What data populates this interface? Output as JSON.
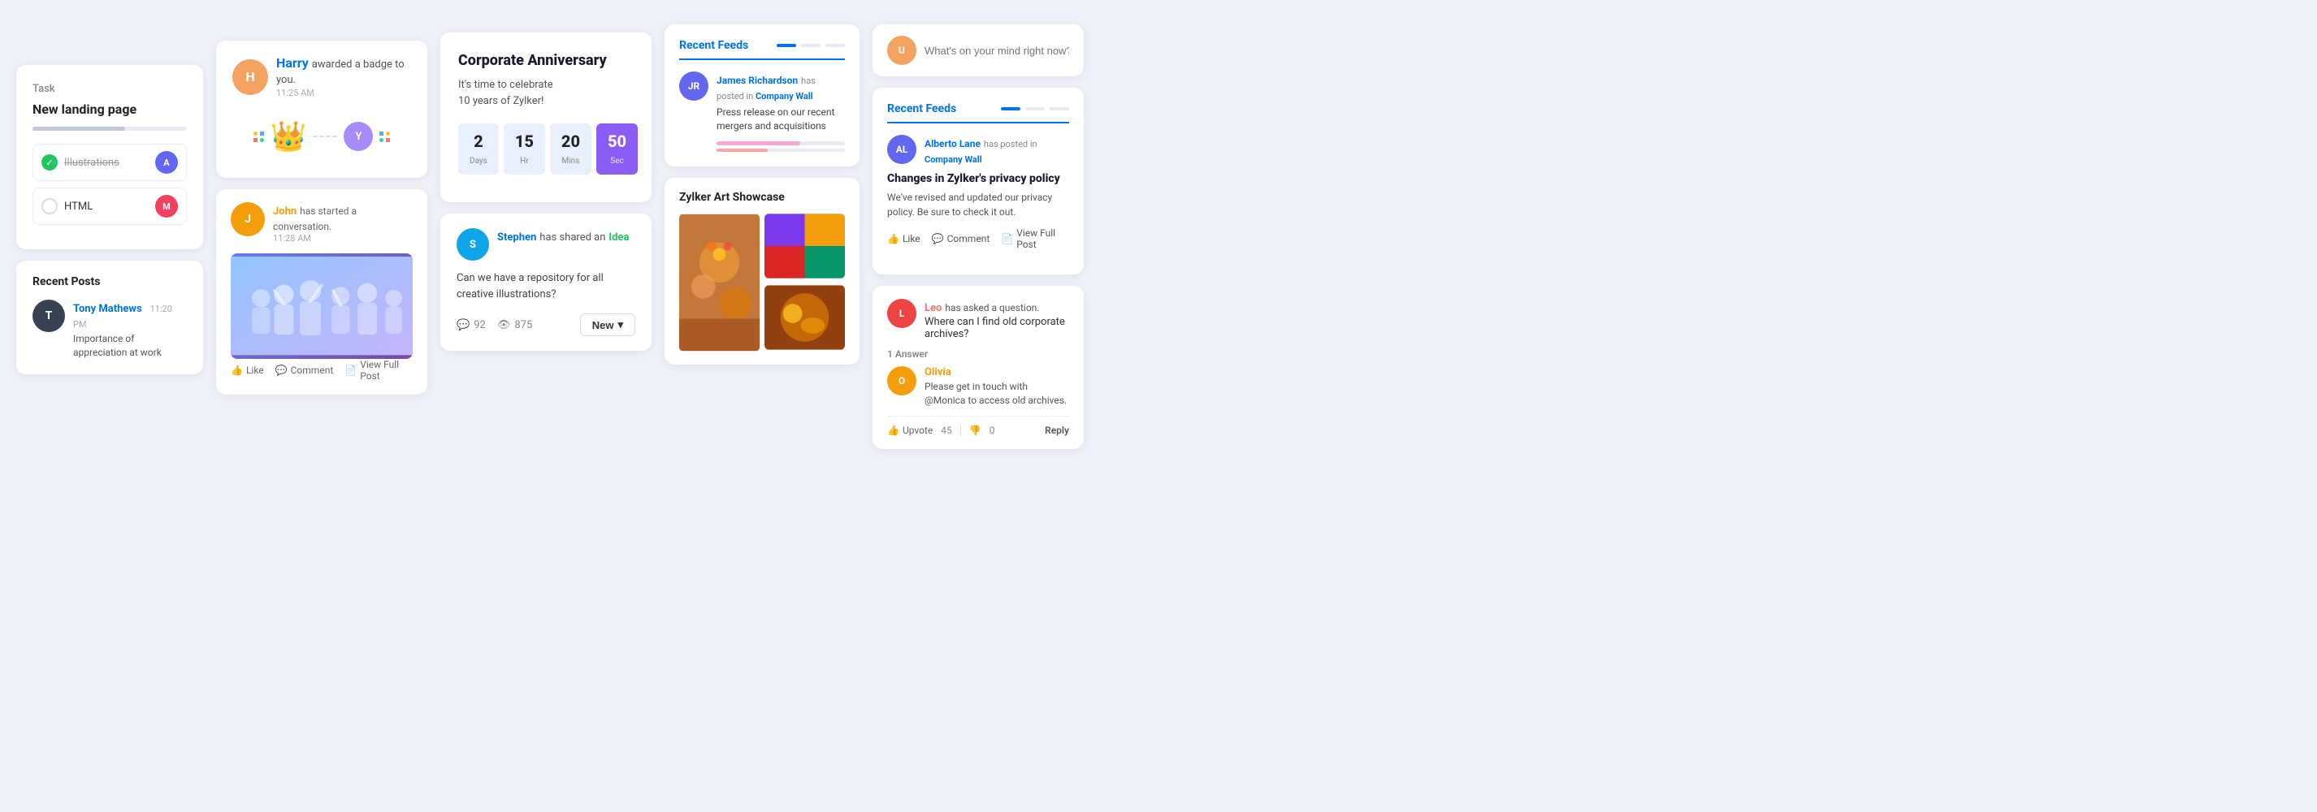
{
  "col1": {
    "task": {
      "label": "Task",
      "title": "New landing page",
      "items": [
        {
          "name": "Illustrations",
          "done": true,
          "avatar_color": "#6366f1",
          "avatar_initial": "A"
        },
        {
          "name": "HTML",
          "done": false,
          "avatar_color": "#f43f5e",
          "avatar_initial": "M"
        }
      ]
    },
    "recent_posts": {
      "title": "Recent Posts",
      "post": {
        "name": "Tony Mathews",
        "time": "11:20 PM",
        "text": "Importance of appreciation at work",
        "avatar_color": "#374151",
        "avatar_initial": "T"
      }
    }
  },
  "col2": {
    "badge": {
      "avatar_color": "#f4a261",
      "avatar_initial": "H",
      "name": "Harry",
      "text": "awarded a badge to you.",
      "time": "11:25 AM",
      "receiver_color": "#a78bfa",
      "receiver_initial": "Y"
    },
    "conversation": {
      "avatar_color": "#f59e0b",
      "avatar_initial": "J",
      "name": "John",
      "text": "has started a conversation.",
      "time": "11:28 AM",
      "actions": {
        "like": "Like",
        "comment": "Comment",
        "view": "View Full Post"
      }
    }
  },
  "col3": {
    "anniversary": {
      "title": "Corporate Anniversary",
      "desc": "It's time to celebrate\n10 years of Zylker!",
      "countdown": [
        {
          "num": "2",
          "label": "Days",
          "accent": false
        },
        {
          "num": "15",
          "label": "Hr",
          "accent": false
        },
        {
          "num": "20",
          "label": "Mins",
          "accent": false
        },
        {
          "num": "50",
          "label": "Sec",
          "accent": true
        }
      ]
    },
    "idea": {
      "avatar_color": "#0ea5e9",
      "avatar_initial": "S",
      "name": "Stephen",
      "action_text": "has shared an",
      "tag": "Idea",
      "desc": "Can we have a repository for all creative illustrations?",
      "comment_count": "92",
      "view_count": "875",
      "new_label": "New"
    }
  },
  "col4": {
    "feeds": {
      "title": "Recent Feeds",
      "item": {
        "avatar_color": "#6366f1",
        "avatar_initial": "JR",
        "name": "James Richardson",
        "action": "has posted in",
        "where": "Company Wall",
        "text": "Press release on our recent mergers and acquisitions"
      }
    },
    "art": {
      "title": "Zylker Art Showcase",
      "images": [
        {
          "color": "#d97706",
          "label": "art1"
        },
        {
          "color": "#22c55e",
          "label": "art2"
        },
        {
          "color": "#8b5cf6",
          "label": "art3"
        },
        {
          "color": "#f59e0b",
          "label": "art4"
        }
      ]
    }
  },
  "col5": {
    "compose": {
      "placeholder": "What's on your mind right now?",
      "avatar_color": "#f4a261",
      "avatar_initial": "U"
    },
    "feed2": {
      "title": "Recent Feeds",
      "poster": {
        "avatar_color": "#6366f1",
        "avatar_initial": "AL",
        "name": "Alberto Lane",
        "action": "has posted in",
        "where": "Company Wall"
      },
      "post_title": "Changes in Zylker's privacy policy",
      "post_text": "We've revised and updated our privacy policy. Be sure to check it out.",
      "actions": {
        "like": "Like",
        "comment": "Comment",
        "view": "View Full Post"
      }
    },
    "qa": {
      "asker": {
        "avatar_color": "#ef4444",
        "avatar_initial": "L",
        "name": "Leo",
        "text": "has asked a question."
      },
      "question": "Where can I find old corporate archives?",
      "answer_count": "1 Answer",
      "answerer": {
        "avatar_color": "#f59e0b",
        "avatar_initial": "O",
        "name": "Olivia",
        "text": "Please get in touch with @Monica to access old archives."
      },
      "upvote_label": "Upvote",
      "upvote_count": "45",
      "downvote_count": "0",
      "reply_label": "Reply"
    }
  }
}
